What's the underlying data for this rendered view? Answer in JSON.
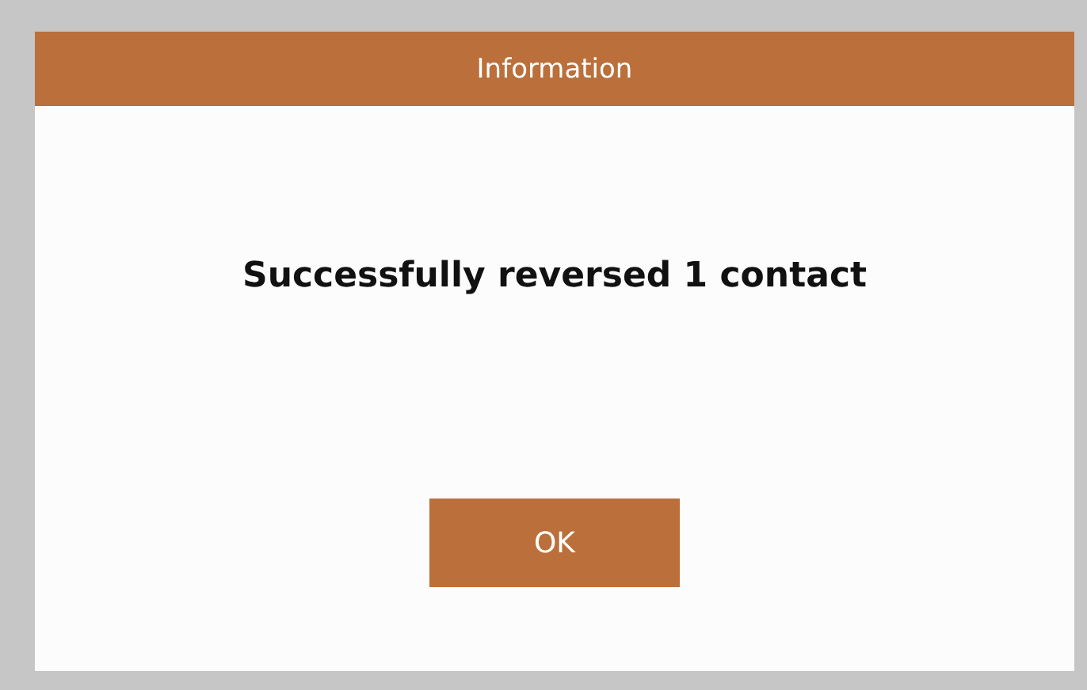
{
  "dialog": {
    "title": "Information",
    "message": "Successfully reversed 1 contact",
    "buttons": [
      "OK"
    ]
  }
}
